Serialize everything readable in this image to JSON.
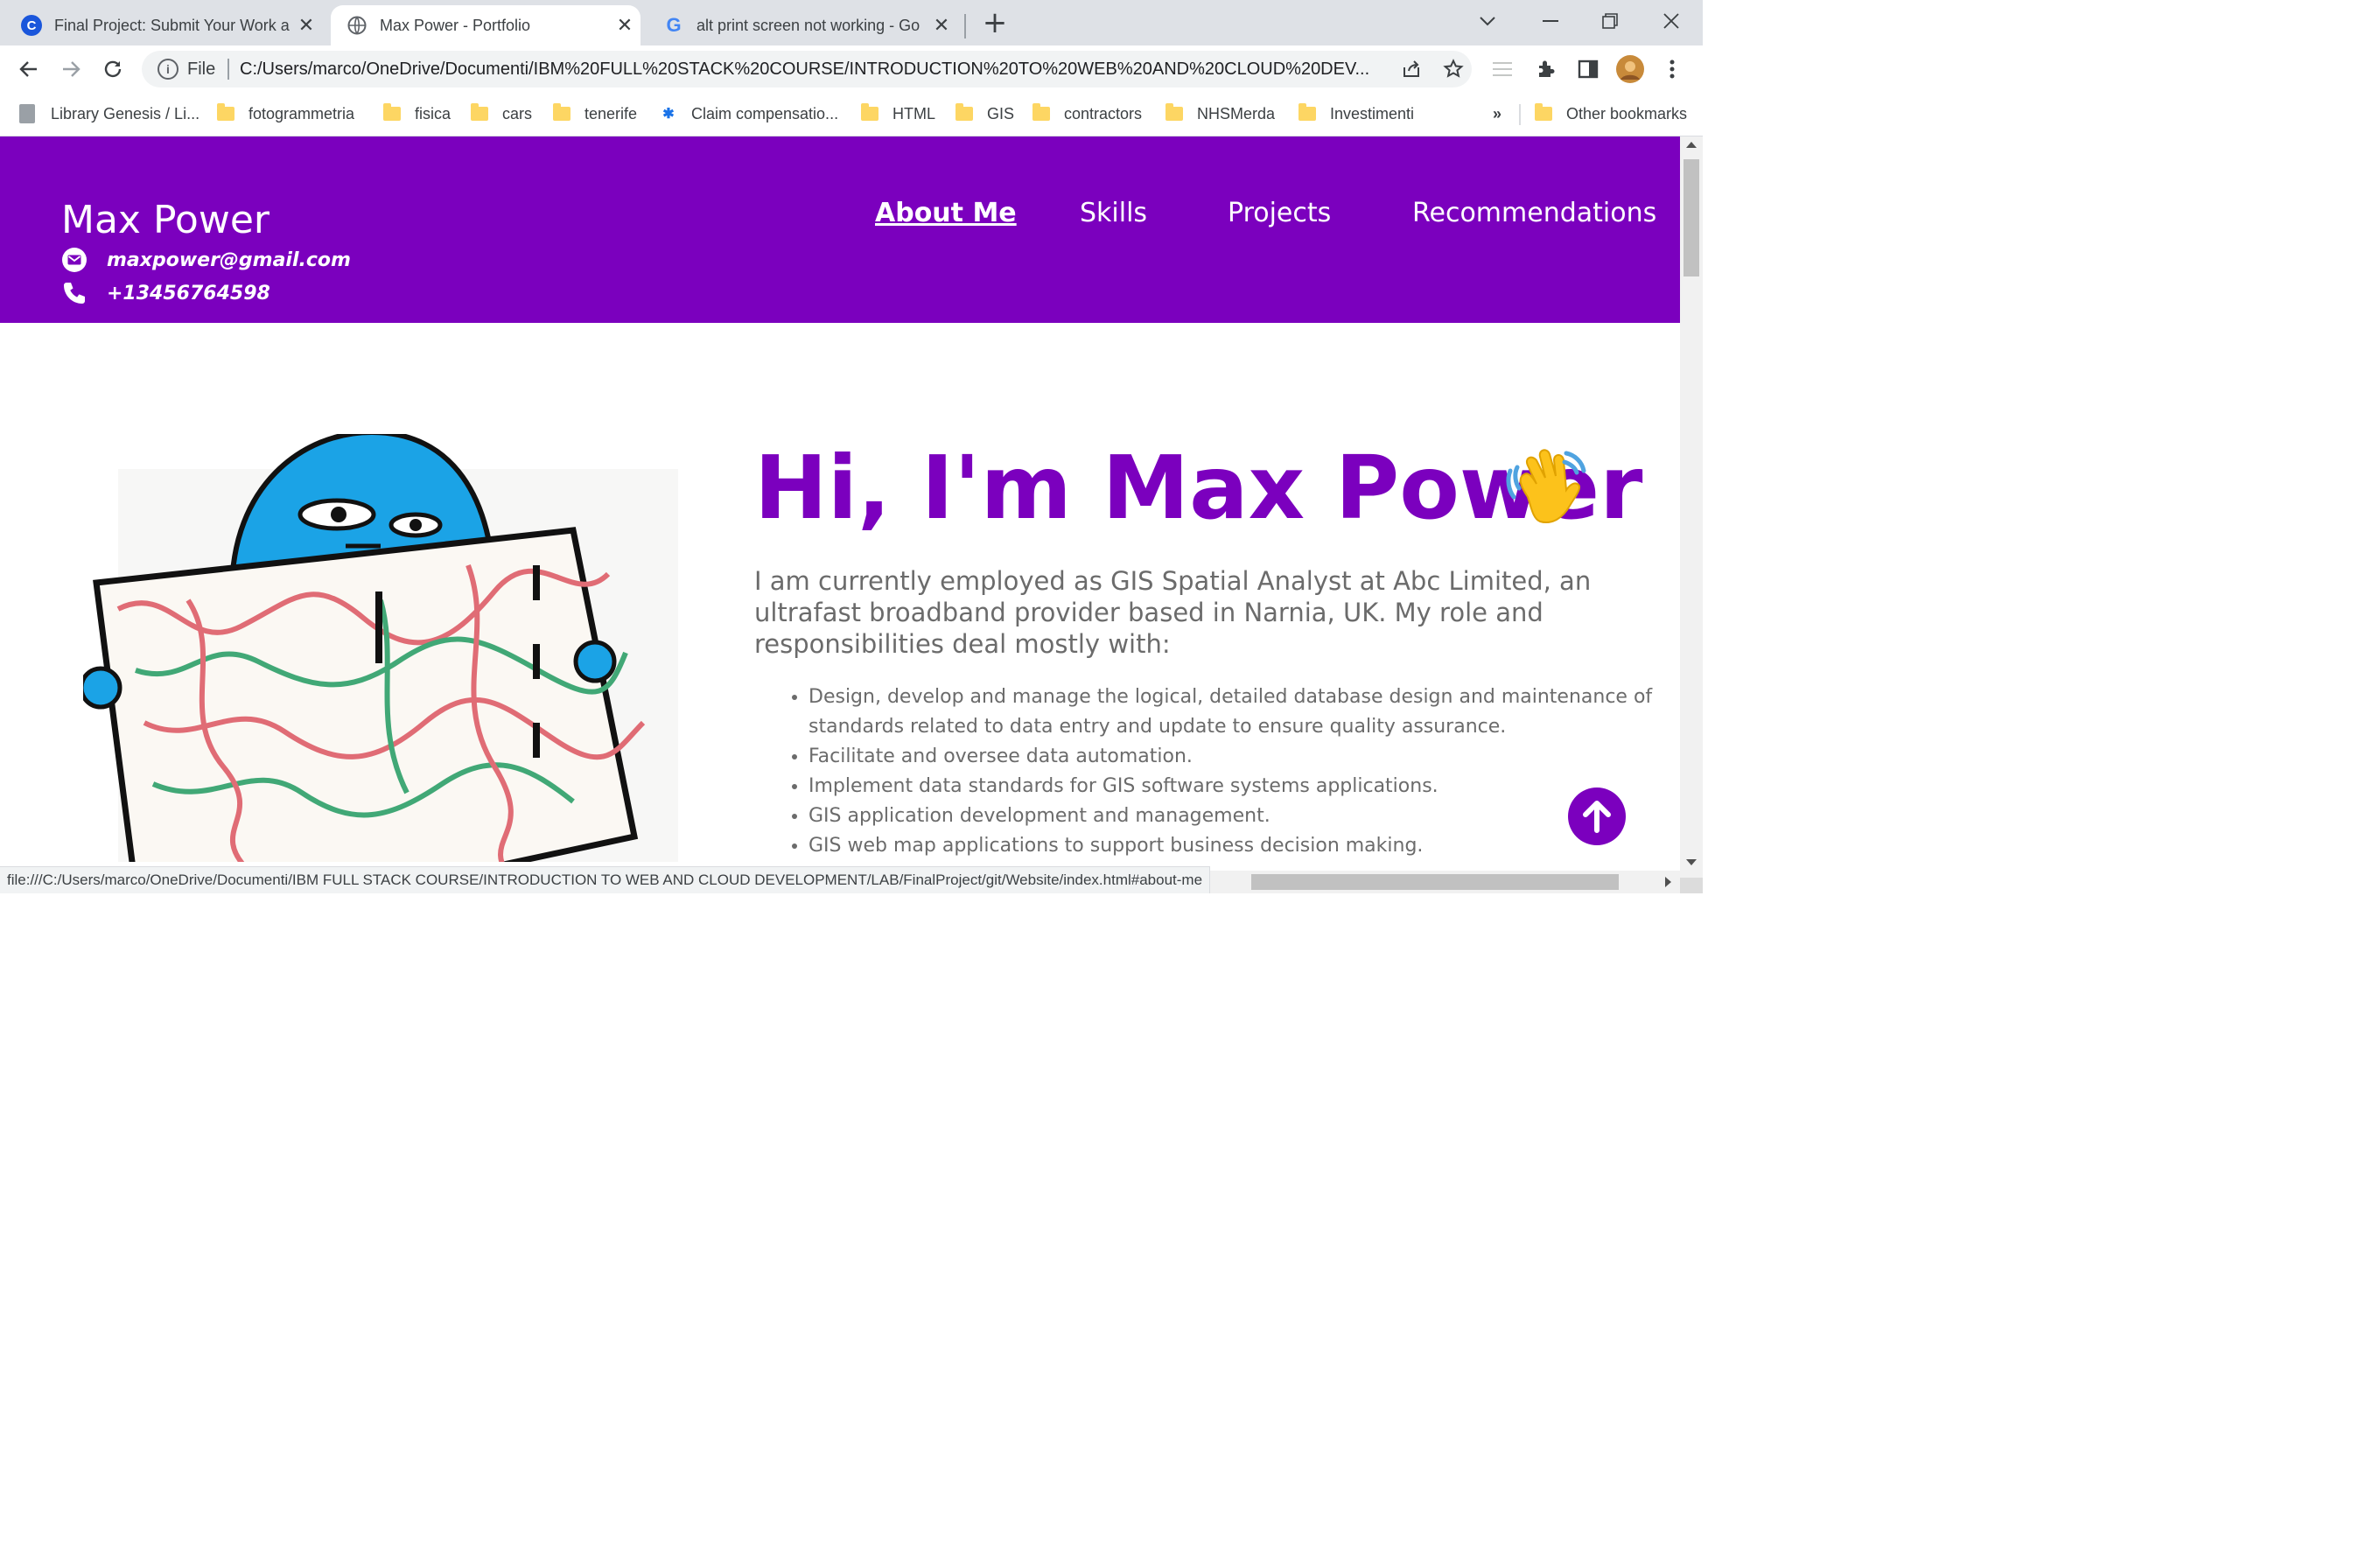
{
  "browser": {
    "tabs": [
      {
        "title": "Final Project: Submit Your Work a",
        "favicon": "C",
        "favicon_color": "#1a56db"
      },
      {
        "title": "Max Power - Portfolio",
        "favicon": "globe-icon",
        "active": true
      },
      {
        "title": "alt print screen not working - Go",
        "favicon": "G"
      }
    ],
    "new_tab_label": "+",
    "address": {
      "scheme_label": "File",
      "url": "C:/Users/marco/OneDrive/Documenti/IBM%20FULL%20STACK%20COURSE/INTRODUCTION%20TO%20WEB%20AND%20CLOUD%20DEV..."
    },
    "bookmarks": [
      "Library Genesis / Li...",
      "fotogrammetria",
      "fisica",
      "cars",
      "tenerife",
      "Claim compensatio...",
      "HTML",
      "GIS",
      "contractors",
      "NHSMerda",
      "Investimenti"
    ],
    "bookmarks_overflow": "»",
    "other_bookmarks": "Other bookmarks",
    "status_url": "file:///C:/Users/marco/OneDrive/Documenti/IBM FULL STACK COURSE/INTRODUCTION TO WEB AND CLOUD DEVELOPMENT/LAB/FinalProject/git/Website/index.html#about-me"
  },
  "site": {
    "name": "Max Power",
    "email": "maxpower@gmail.com",
    "phone": "+13456764598",
    "nav": [
      "About Me",
      "Skills",
      "Projects",
      "Recommendations"
    ],
    "active_nav": "About Me",
    "hero_title": "Hi, I'm Max Power",
    "intro": "I am currently employed as GIS Spatial Analyst at Abc Limited, an ultrafast broadband provider based in Narnia, UK. My role and responsibilities deal mostly with:",
    "duties": [
      "Design, develop and manage the logical, detailed database design and maintenance of standards related to data entry and update to ensure quality assurance.",
      "Facilitate and oversee data automation.",
      "Implement data standards for GIS software systems applications.",
      "GIS application development and management.",
      "GIS web map applications to support business decision making."
    ]
  },
  "colors": {
    "brand_purple": "#7b00be",
    "tab_strip": "#dee1e6",
    "body_text": "#6b6b6b"
  }
}
